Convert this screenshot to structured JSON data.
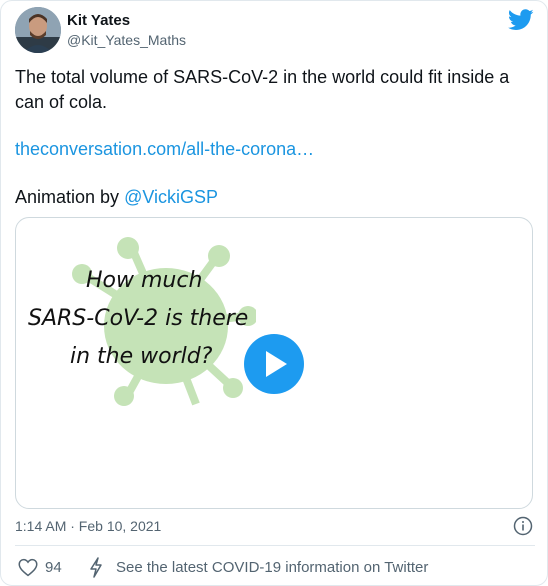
{
  "author": {
    "name": "Kit Yates",
    "handle": "@Kit_Yates_Maths"
  },
  "tweet": {
    "text": "The total volume of SARS-CoV-2 in the world could fit inside a can of cola.",
    "link": "theconversation.com/all-the-corona…",
    "credit_prefix": "Animation by ",
    "credit_mention": "@VickiGSP"
  },
  "media": {
    "title_line1": "How much",
    "title_line2": "SARS-CoV-2 is there",
    "title_line3": "in the world?"
  },
  "footer": {
    "timestamp": "1:14 AM · Feb 10, 2021",
    "likes": "94",
    "covid_info": "See the latest COVID-19 information on Twitter"
  },
  "colors": {
    "accent": "#1d9bf0",
    "link": "#1b95e0",
    "virus_green": "#c5e3b7"
  },
  "icons": [
    "twitter-bird-icon",
    "info-icon",
    "heart-icon",
    "lightning-icon",
    "play-icon"
  ]
}
